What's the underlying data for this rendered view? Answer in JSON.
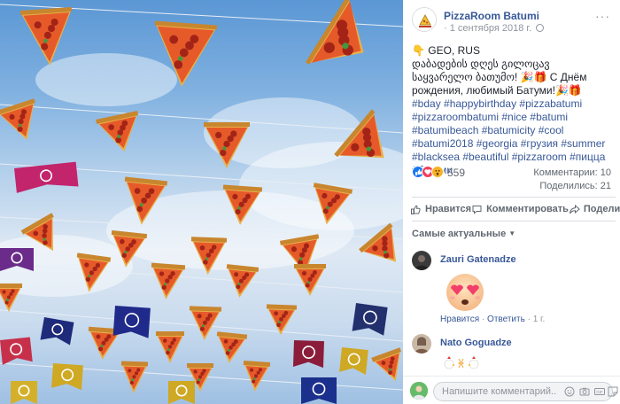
{
  "post": {
    "page_name": "PizzaRoom Batumi",
    "date": "1 сентября 2018 г.",
    "meta_separator": "·",
    "more_label": "···",
    "text_line1": "👇 GEO, RUS",
    "text_line2": "დაბადების დღეს გილოცავ საყვარელო ბათუმო! 🎉🎁 С Днём рождения, любимый Батуми!🎉🎁",
    "hashtags": "#bday #happybirthday #pizzabatumi #pizzaroombatumi #nice #batumi #batumibeach #batumicity #cool #batumi2018 #georgia #грузия #summer #blacksea #beautiful #pizzaroom #пицца #батуми"
  },
  "reactions": {
    "count": "559",
    "comments_label": "Комментарии: 10",
    "shares_label": "Поделились: 21",
    "icons": [
      "like-icon",
      "love-icon",
      "wow-icon"
    ]
  },
  "actions": {
    "like": "Нравится",
    "comment": "Комментировать",
    "share": "Поделиться"
  },
  "sort": {
    "label": "Самые актуальные"
  },
  "comments": [
    {
      "author": "Zauri Gatenadze",
      "sticker": "heart-eyes-emoji-sticker",
      "like_label": "Нравится",
      "sep1": "·",
      "reply_label": "Ответить",
      "sep2": "·",
      "age": "1 г."
    },
    {
      "author": "Nato Goguadze",
      "sticker": "chicken-sticker"
    }
  ],
  "composer": {
    "placeholder": "Напишите комментарий..."
  },
  "colors": {
    "link_blue": "#385898",
    "muted": "#606770",
    "sky": "#7fb0e0"
  }
}
